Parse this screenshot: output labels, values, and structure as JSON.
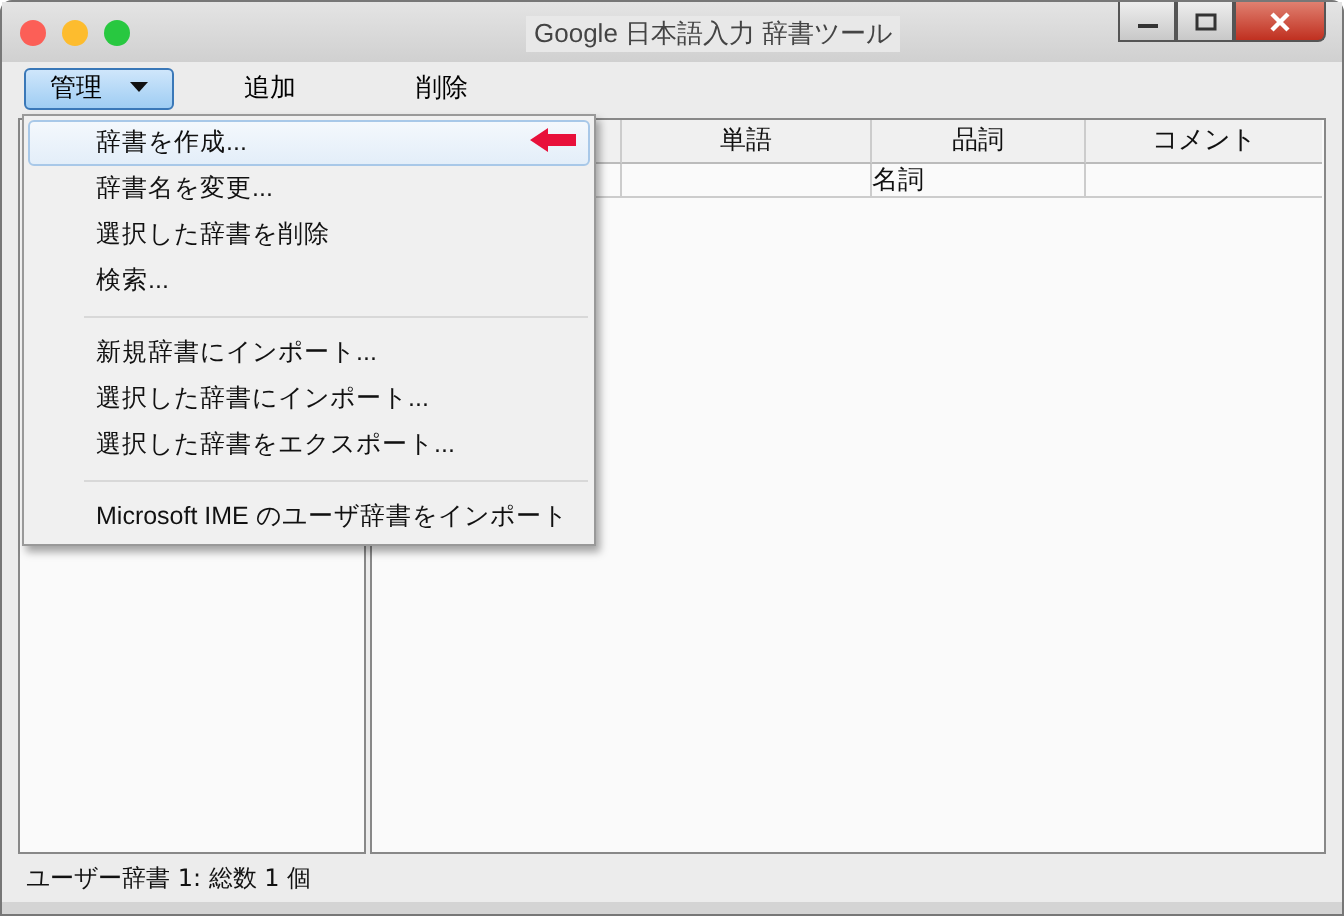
{
  "window": {
    "title": "Google 日本語入力 辞書ツール"
  },
  "toolbar": [
    {
      "label": "管理",
      "kind": "dropdown",
      "selected": true
    },
    {
      "label": "追加",
      "kind": "plain",
      "selected": false
    },
    {
      "label": "削除",
      "kind": "plain",
      "selected": false
    }
  ],
  "menu": {
    "groups": [
      [
        {
          "label": "辞書を作成...",
          "selected": true
        },
        {
          "label": "辞書名を変更...",
          "selected": false
        },
        {
          "label": "選択した辞書を削除",
          "selected": false
        },
        {
          "label": "検索...",
          "selected": false
        }
      ],
      [
        {
          "label": "新規辞書にインポート...",
          "selected": false
        },
        {
          "label": "選択した辞書にインポート...",
          "selected": false
        },
        {
          "label": "選択した辞書をエクスポート...",
          "selected": false
        }
      ],
      [
        {
          "label": "Microsoft IME のユーザ辞書をインポート",
          "selected": false
        }
      ]
    ]
  },
  "table": {
    "columns": [
      "単語",
      "品詞",
      "コメント"
    ],
    "rows": [
      {
        "cells": [
          null,
          "名詞",
          null
        ]
      }
    ]
  },
  "status_bar": "ユーザー辞書 1: 総数 1 個"
}
